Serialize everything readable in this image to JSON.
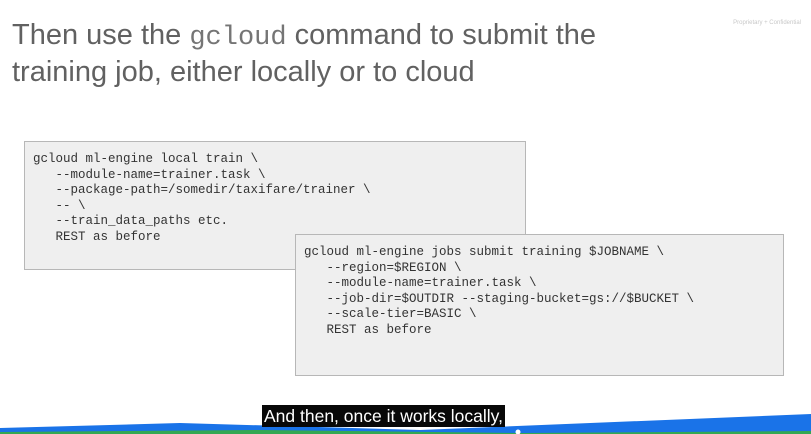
{
  "slide": {
    "title_before": "Then use the ",
    "title_code": "gcloud",
    "title_after": " command to submit the training job, either locally or to cloud",
    "confidential": "Proprietary + Confidential"
  },
  "local_code": {
    "lines": [
      "gcloud ml-engine local train \\",
      "   --module-name=trainer.task \\",
      "   --package-path=/somedir/taxifare/trainer \\",
      "   -- \\",
      "   --train_data_paths etc.",
      "   REST as before"
    ]
  },
  "cloud_code": {
    "lines": [
      "gcloud ml-engine jobs submit training $JOBNAME \\",
      "   --region=$REGION \\",
      "   --module-name=trainer.task \\",
      "   --job-dir=$OUTDIR --staging-bucket=gs://$BUCKET \\",
      "   --scale-tier=BASIC \\",
      "   REST as before"
    ]
  },
  "caption": {
    "text": "And then, once it works locally,"
  },
  "colors": {
    "accent_blue": "#1a73e8",
    "accent_green": "#34a853"
  }
}
